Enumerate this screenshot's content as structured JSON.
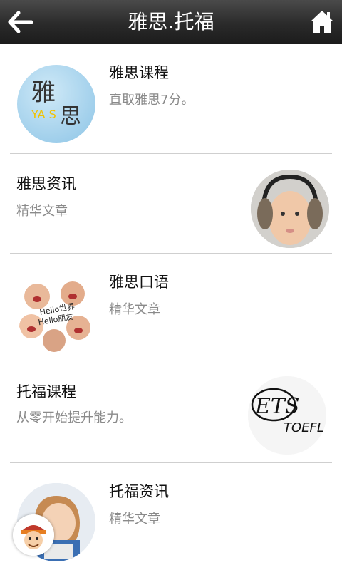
{
  "header": {
    "title": "雅思.托福"
  },
  "items": [
    {
      "title": "雅思课程",
      "subtitle": "直取雅思7分。",
      "logo_text_cn": "雅",
      "logo_text_en": "YA S",
      "logo_text_cn2": "思"
    },
    {
      "title": "雅思资讯",
      "subtitle": "精华文章"
    },
    {
      "title": "雅思口语",
      "subtitle": "精华文章",
      "photo_text1": "Hello世界",
      "photo_text2": "Hello朋友"
    },
    {
      "title": "托福课程",
      "subtitle": "从零开始提升能力。",
      "logo_text1": "ETS",
      "logo_text2": "TOEFL"
    },
    {
      "title": "托福资讯",
      "subtitle": "精华文章"
    }
  ]
}
